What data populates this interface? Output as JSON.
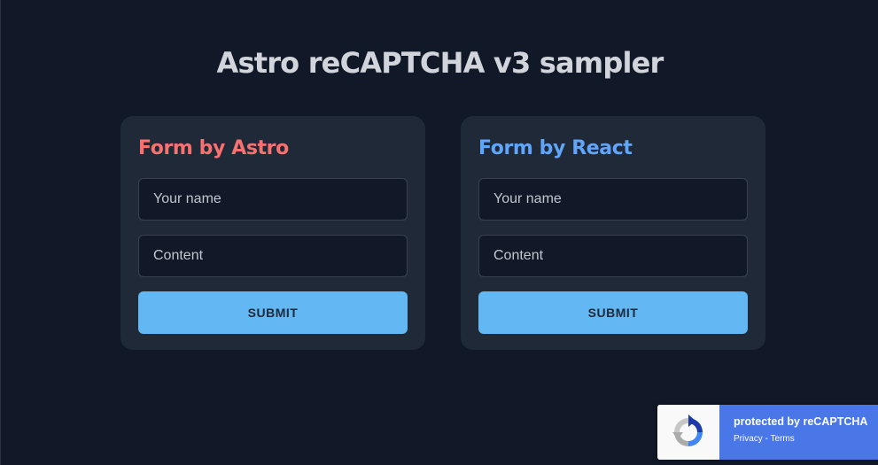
{
  "page": {
    "title": "Astro reCAPTCHA v3 sampler"
  },
  "forms": {
    "astro": {
      "title": "Form by Astro",
      "name_placeholder": "Your name",
      "content_placeholder": "Content",
      "submit_label": "SUBMIT"
    },
    "react": {
      "title": "Form by React",
      "name_placeholder": "Your name",
      "content_placeholder": "Content",
      "submit_label": "SUBMIT"
    }
  },
  "recaptcha_badge": {
    "text": "protected by reCAPTCHA",
    "privacy_label": "Privacy",
    "separator": " - ",
    "terms_label": "Terms",
    "icon": "recaptcha-logo-icon"
  },
  "colors": {
    "background": "#111827",
    "card": "#1f2937",
    "astro_accent": "#f87171",
    "react_accent": "#60a5fa",
    "button": "#63b7f2",
    "badge_blue": "#4a77e8"
  }
}
